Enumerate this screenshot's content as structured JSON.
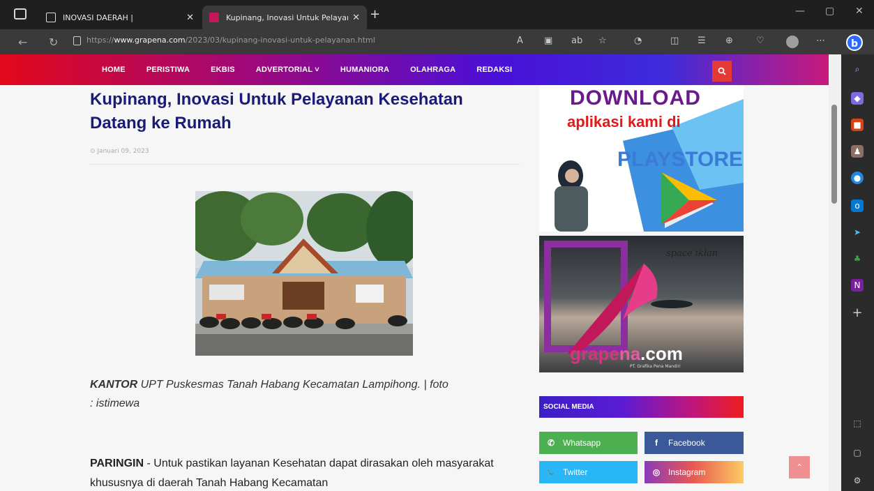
{
  "browser": {
    "tabs": [
      {
        "title": "INOVASI DAERAH |",
        "active": false
      },
      {
        "title": "Kupinang, Inovasi Untuk Pelayan",
        "active": true
      }
    ],
    "url_prefix": "https://",
    "url_domain": "www.grapena.com",
    "url_path": "/2023/03/kupinang-inovasi-untuk-pelayanan.html"
  },
  "site": {
    "menu": [
      "HOME",
      "PERISTIWA",
      "EKBIS",
      "ADVERTORIAL ˅",
      "HUMANIORA",
      "OLAHRAGA",
      "REDAKSI"
    ]
  },
  "article": {
    "title": "Kupinang, Inovasi Untuk Pelayanan Kesehatan Datang ke Rumah",
    "date": "Januari 09, 2023",
    "caption_bold": "KANTOR",
    "caption_rest": " UPT Puskesmas Tanah Habang Kecamatan Lampihong. | foto : istimewa",
    "para_bold": "PARINGIN",
    "para_rest": " - Untuk pastikan layanan Kesehatan dapat dirasakan oleh masyarakat khususnya di daerah Tanah Habang Kecamatan"
  },
  "ads": {
    "ad1_line1": "DOWNLOAD",
    "ad1_line2": "aplikasi kami di",
    "ad1_line3": "PLAYSTORE",
    "ad2_tag": "space iklan",
    "ad2_brand_a": "grape",
    "ad2_brand_b": "na",
    "ad2_brand_c": ".com",
    "ad2_company": "PT. Grafika Pena Mandiri"
  },
  "social": {
    "heading": "SOCIAL MEDIA",
    "items": [
      {
        "label": "Whatsapp",
        "color": "#4caf50"
      },
      {
        "label": "Facebook",
        "color": "#3b5998"
      },
      {
        "label": "Twitter",
        "color": "#29b6f6"
      },
      {
        "label": "Instagram",
        "color": "#c13584"
      }
    ]
  }
}
